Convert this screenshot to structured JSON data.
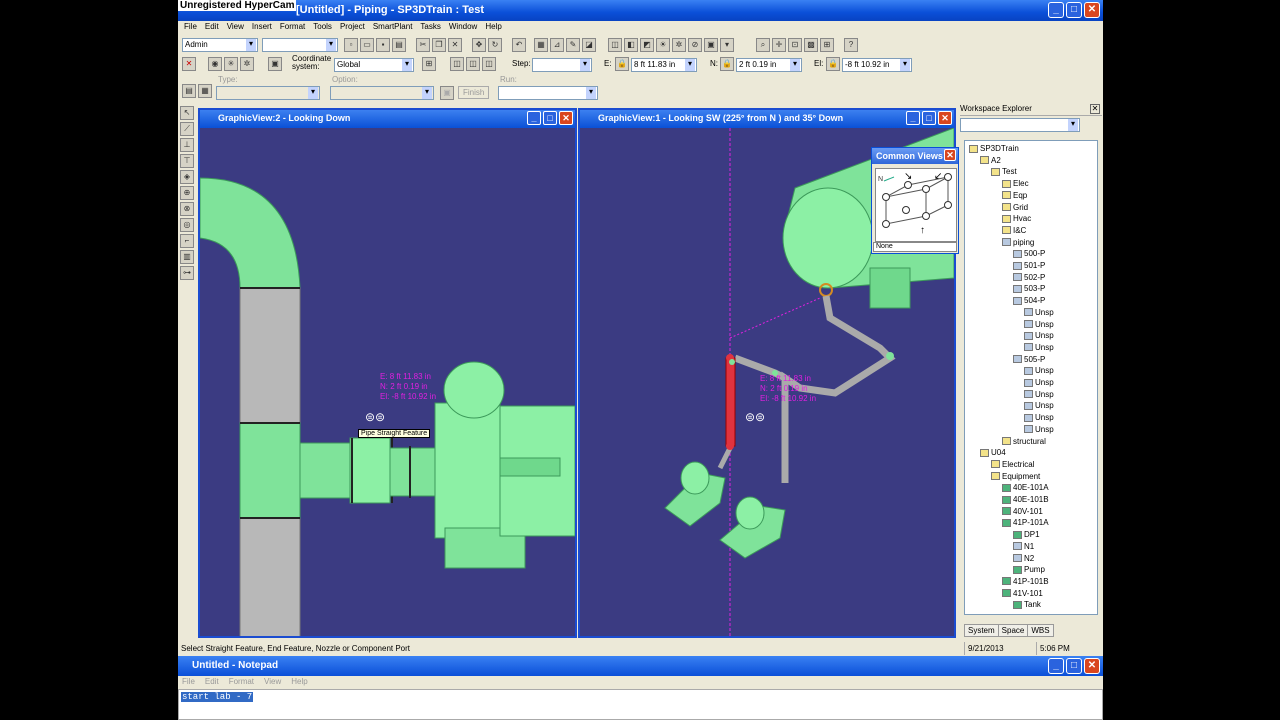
{
  "app": {
    "title": "[Untitled] - Piping - SP3DTrain : Test",
    "watermark": "Unregistered HyperCam"
  },
  "menu": [
    "File",
    "Edit",
    "View",
    "Insert",
    "Format",
    "Tools",
    "Project",
    "SmartPlant",
    "Tasks",
    "Window",
    "Help"
  ],
  "toolbar": {
    "permission_group": "Admin",
    "coordinate_label": "Coordinate system:",
    "coordinate_value": "Global",
    "step_label": "Step:",
    "e_label": "E:",
    "e_value": "8 ft 11.83 in",
    "n_label": "N:",
    "n_value": "2 ft 0.19 in",
    "el_label": "El:",
    "el_value": "-8 ft 10.92 in",
    "type_label": "Type:",
    "option_label": "Option:",
    "finish_label": "Finish",
    "run_label": "Run:"
  },
  "views": {
    "left_title": "GraphicView:2 - Looking Down",
    "right_title": "GraphicView:1 - Looking SW (225° from N ) and 35° Down"
  },
  "readout": {
    "e": "E: 8 ft 11.83 in",
    "n": "N: 2 ft 0.19 in",
    "el": "El: -8 ft 10.92 in"
  },
  "tooltip": "Pipe Straight Feature",
  "common_views": {
    "title": "Common Views",
    "footer": "None",
    "north": "N"
  },
  "explorer": {
    "title": "Workspace Explorer",
    "tree": [
      {
        "label": "SP3DTrain",
        "level": 0,
        "icon": "folder"
      },
      {
        "label": "A2",
        "level": 1,
        "icon": "folder"
      },
      {
        "label": "Test",
        "level": 2,
        "icon": "folder"
      },
      {
        "label": "Elec",
        "level": 3,
        "icon": "folder"
      },
      {
        "label": "Eqp",
        "level": 3,
        "icon": "folder"
      },
      {
        "label": "Grid",
        "level": 3,
        "icon": "folder"
      },
      {
        "label": "Hvac",
        "level": 3,
        "icon": "folder"
      },
      {
        "label": "I&C",
        "level": 3,
        "icon": "folder"
      },
      {
        "label": "piping",
        "level": 3,
        "icon": "pipe"
      },
      {
        "label": "500-P",
        "level": 4,
        "icon": "pipe"
      },
      {
        "label": "501-P",
        "level": 4,
        "icon": "pipe"
      },
      {
        "label": "502-P",
        "level": 4,
        "icon": "pipe"
      },
      {
        "label": "503-P",
        "level": 4,
        "icon": "pipe"
      },
      {
        "label": "504-P",
        "level": 4,
        "icon": "pipe"
      },
      {
        "label": "Unsp",
        "level": 5,
        "icon": "pipe"
      },
      {
        "label": "Unsp",
        "level": 5,
        "icon": "pipe"
      },
      {
        "label": "Unsp",
        "level": 5,
        "icon": "pipe"
      },
      {
        "label": "Unsp",
        "level": 5,
        "icon": "pipe"
      },
      {
        "label": "505-P",
        "level": 4,
        "icon": "pipe"
      },
      {
        "label": "Unsp",
        "level": 5,
        "icon": "pipe"
      },
      {
        "label": "Unsp",
        "level": 5,
        "icon": "pipe"
      },
      {
        "label": "Unsp",
        "level": 5,
        "icon": "pipe"
      },
      {
        "label": "Unsp",
        "level": 5,
        "icon": "pipe"
      },
      {
        "label": "Unsp",
        "level": 5,
        "icon": "pipe"
      },
      {
        "label": "Unsp",
        "level": 5,
        "icon": "pipe"
      },
      {
        "label": "structural",
        "level": 3,
        "icon": "folder"
      },
      {
        "label": "U04",
        "level": 1,
        "icon": "folder"
      },
      {
        "label": "Electrical",
        "level": 2,
        "icon": "folder"
      },
      {
        "label": "Equipment",
        "level": 2,
        "icon": "folder"
      },
      {
        "label": "40E-101A",
        "level": 3,
        "icon": "eq"
      },
      {
        "label": "40E-101B",
        "level": 3,
        "icon": "eq"
      },
      {
        "label": "40V-101",
        "level": 3,
        "icon": "eq"
      },
      {
        "label": "41P-101A",
        "level": 3,
        "icon": "eq"
      },
      {
        "label": "DP1",
        "level": 4,
        "icon": "eq"
      },
      {
        "label": "N1",
        "level": 4,
        "icon": "pipe"
      },
      {
        "label": "N2",
        "level": 4,
        "icon": "pipe"
      },
      {
        "label": "Pump",
        "level": 4,
        "icon": "eq"
      },
      {
        "label": "41P-101B",
        "level": 3,
        "icon": "eq"
      },
      {
        "label": "41V-101",
        "level": 3,
        "icon": "eq"
      },
      {
        "label": "Tank",
        "level": 4,
        "icon": "eq"
      }
    ],
    "tabs": [
      "System",
      "Space",
      "WBS"
    ]
  },
  "status": {
    "message": "Select Straight Feature, End Feature, Nozzle or Component Port",
    "date": "9/21/2013",
    "time": "5:06 PM"
  },
  "notepad": {
    "title": "Untitled - Notepad",
    "menu": [
      "File",
      "Edit",
      "Format",
      "View",
      "Help"
    ],
    "text": "start lab - 7"
  }
}
